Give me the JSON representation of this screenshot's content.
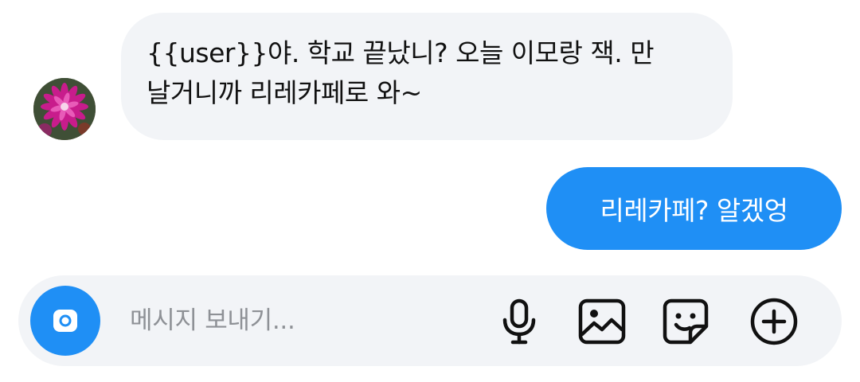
{
  "messages": [
    {
      "direction": "incoming",
      "text": "{{user}}야. 학교 끝났니? 오늘 이모랑 잭. 만\n날거니까 리레카페로 와~"
    },
    {
      "direction": "outgoing",
      "text": "리레카페? 알겠엉"
    }
  ],
  "composer": {
    "placeholder": "메시지 보내기..."
  },
  "icons": {
    "camera": "camera-icon",
    "mic": "microphone-icon",
    "gallery": "image-icon",
    "sticker": "sticker-icon",
    "plus": "plus-circle-icon"
  },
  "colors": {
    "accent": "#1f8ff5",
    "incoming_bubble": "#f2f4f7",
    "outgoing_text": "#ffffff",
    "placeholder": "#8e9196"
  }
}
